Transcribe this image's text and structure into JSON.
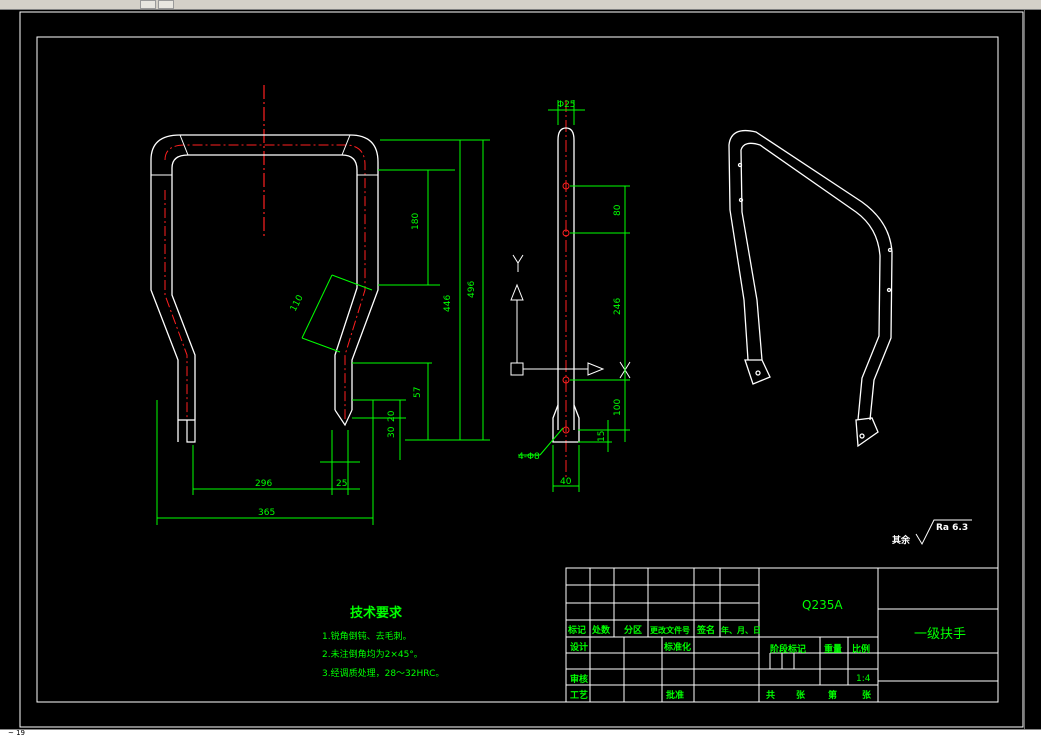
{
  "status": {
    "coords_label": "~ 19"
  },
  "colors": {
    "background": "#000000",
    "outline": "#ffffff",
    "dimension": "#00ff00",
    "centerline": "#ff2020",
    "title_text": "#00ff00"
  },
  "front_view": {
    "dims": {
      "d180": "180",
      "d110": "110",
      "d446": "446",
      "d496": "496",
      "d57": "57",
      "d20": "20",
      "d30": "30",
      "d296": "296",
      "d25": "25",
      "d365": "365"
    }
  },
  "side_view": {
    "dims": {
      "phi25": "Φ25",
      "d80": "80",
      "d246": "246",
      "d100": "100",
      "d15": "15",
      "holes": "4-Φ8",
      "d40": "40"
    },
    "axis_y": "Y",
    "axis_x": "X"
  },
  "roughness": {
    "label": "其余",
    "value": "Ra 6.3"
  },
  "tech_requirements": {
    "title": "技术要求",
    "items": [
      "1.锐角倒钝、去毛刺。",
      "2.未注倒角均为2×45°。",
      "3.经调质处理，28～32HRC。"
    ]
  },
  "title_block": {
    "material": "Q235A",
    "part_name": "一级扶手",
    "row_labels": [
      "标记",
      "处数",
      "分区",
      "更改文件号",
      "签名",
      "年、月、日"
    ],
    "design": "设计",
    "standardize": "标准化",
    "stage_mark": "阶段标记",
    "weight": "重量",
    "scale_label": "比例",
    "scale": "1:4",
    "review": "审核",
    "process": "工艺",
    "approve": "批准",
    "sheet_total": "共",
    "sheet_unit": "张",
    "sheet_no": "第",
    "sheet_unit2": "张"
  }
}
